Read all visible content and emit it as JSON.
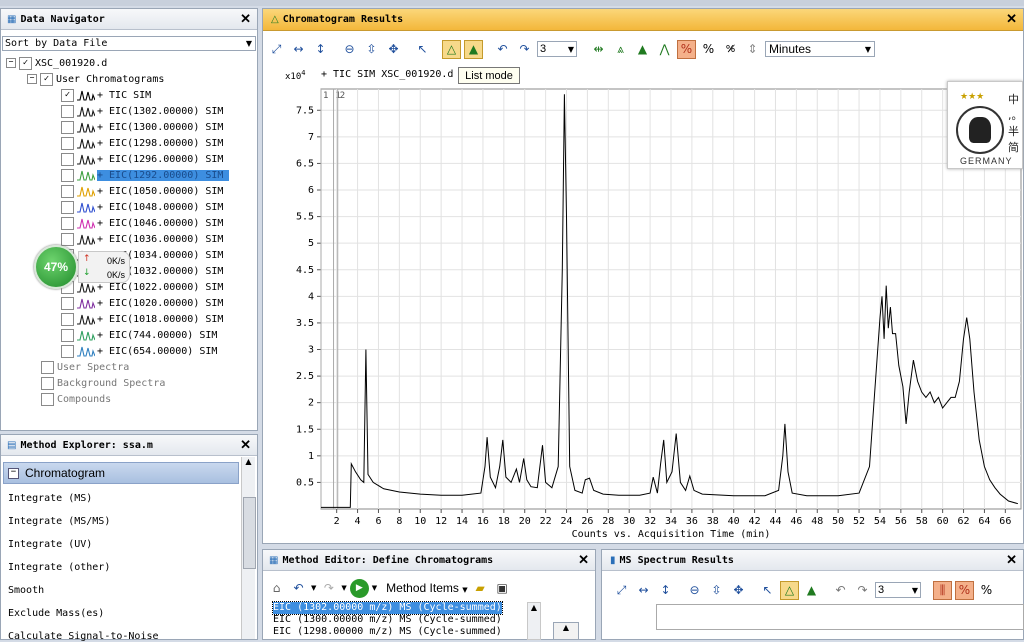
{
  "nav": {
    "title": "Data Navigator",
    "sort": "Sort by Data File",
    "file": "XSC_001920.d",
    "group": "User Chromatograms",
    "chromatograms": [
      {
        "label": "+ TIC SIM",
        "checked": true,
        "color": "#000000",
        "selected": false
      },
      {
        "label": "+ EIC(1302.00000) SIM",
        "checked": false,
        "color": "#1a1a1a",
        "selected": false
      },
      {
        "label": "+ EIC(1300.00000) SIM",
        "checked": false,
        "color": "#1a1a1a",
        "selected": false
      },
      {
        "label": "+ EIC(1298.00000) SIM",
        "checked": false,
        "color": "#1a1a1a",
        "selected": false
      },
      {
        "label": "+ EIC(1296.00000) SIM",
        "checked": false,
        "color": "#1a1a1a",
        "selected": false
      },
      {
        "label": "+ EIC(1292.00000) SIM",
        "checked": false,
        "color": "#3ea040",
        "selected": true
      },
      {
        "label": "+ EIC(1050.00000) SIM",
        "checked": false,
        "color": "#e0a000",
        "selected": false
      },
      {
        "label": "+ EIC(1048.00000) SIM",
        "checked": false,
        "color": "#3050d0",
        "selected": false
      },
      {
        "label": "+ EIC(1046.00000) SIM",
        "checked": false,
        "color": "#d030b0",
        "selected": false
      },
      {
        "label": "+ EIC(1036.00000) SIM",
        "checked": false,
        "color": "#1a1a1a",
        "selected": false
      },
      {
        "label": "+ EIC(1034.00000) SIM",
        "checked": false,
        "color": "#1a1a1a",
        "selected": false
      },
      {
        "label": "+ EIC(1032.00000) SIM",
        "checked": false,
        "color": "#1a1a1a",
        "selected": false
      },
      {
        "label": "+ EIC(1022.00000) SIM",
        "checked": false,
        "color": "#1a1a1a",
        "selected": false
      },
      {
        "label": "+ EIC(1020.00000) SIM",
        "checked": false,
        "color": "#8030a0",
        "selected": false
      },
      {
        "label": "+ EIC(1018.00000) SIM",
        "checked": false,
        "color": "#1a1a1a",
        "selected": false
      },
      {
        "label": "+ EIC(744.00000) SIM",
        "checked": false,
        "color": "#30a060",
        "selected": false
      },
      {
        "label": "+ EIC(654.00000) SIM",
        "checked": false,
        "color": "#3080c0",
        "selected": false
      }
    ],
    "other_nodes": [
      "User Spectra",
      "Background Spectra",
      "Compounds"
    ]
  },
  "net_widget": {
    "percent": "47%",
    "up": "0K/s",
    "down": "0K/s"
  },
  "method_explorer": {
    "title": "Method Explorer: ssa.m",
    "section": "Chromatogram",
    "items": [
      "Integrate (MS)",
      "Integrate (MS/MS)",
      "Integrate (UV)",
      "Integrate (other)",
      "Smooth",
      "Exclude Mass(es)",
      "Calculate Signal-to-Noise"
    ]
  },
  "chrom": {
    "title": "Chromatogram Results",
    "toolbar_number": "3",
    "units": "Minutes",
    "tooltip": "List mode",
    "exponent": "x10",
    "exponent_power": "4",
    "trace_label": "+ TIC SIM XSC_001920.d",
    "markers": [
      "1",
      "1",
      "2"
    ],
    "xlabel": "Counts vs. Acquisition Time (min)"
  },
  "chart_data": {
    "type": "line",
    "title": "+ TIC SIM XSC_001920.d",
    "xlabel": "Counts vs. Acquisition Time (min)",
    "ylabel": "",
    "xlim": [
      0.5,
      67.5
    ],
    "ylim": [
      0,
      7.9
    ],
    "x_ticks": [
      2,
      4,
      6,
      8,
      10,
      12,
      14,
      16,
      18,
      20,
      22,
      24,
      26,
      28,
      30,
      32,
      34,
      36,
      38,
      40,
      42,
      44,
      46,
      48,
      50,
      52,
      54,
      56,
      58,
      60,
      62,
      64,
      66
    ],
    "y_ticks": [
      0.5,
      1,
      1.5,
      2,
      2.5,
      3,
      3.5,
      4,
      4.5,
      5,
      5.5,
      6,
      6.5,
      7,
      7.5
    ],
    "grid": true,
    "series": [
      {
        "values": [
          [
            0.5,
            0.03
          ],
          [
            3.3,
            0.03
          ],
          [
            3.4,
            0.85
          ],
          [
            3.8,
            0.7
          ],
          [
            4.3,
            0.55
          ],
          [
            4.6,
            0.5
          ],
          [
            4.8,
            3.0
          ],
          [
            5.0,
            0.65
          ],
          [
            5.5,
            0.5
          ],
          [
            6.5,
            0.38
          ],
          [
            8,
            0.32
          ],
          [
            10,
            0.28
          ],
          [
            12,
            0.26
          ],
          [
            14,
            0.26
          ],
          [
            15.8,
            0.3
          ],
          [
            16.2,
            0.8
          ],
          [
            16.4,
            1.35
          ],
          [
            16.7,
            0.6
          ],
          [
            17.2,
            0.4
          ],
          [
            17.6,
            0.8
          ],
          [
            17.9,
            1.3
          ],
          [
            18.2,
            0.6
          ],
          [
            18.7,
            0.5
          ],
          [
            19.2,
            0.75
          ],
          [
            19.5,
            0.5
          ],
          [
            19.9,
            0.95
          ],
          [
            20.2,
            0.55
          ],
          [
            20.6,
            0.42
          ],
          [
            21.2,
            0.4
          ],
          [
            21.7,
            1.2
          ],
          [
            22.0,
            0.5
          ],
          [
            22.6,
            0.4
          ],
          [
            23.2,
            0.8
          ],
          [
            23.6,
            4.5
          ],
          [
            23.8,
            7.8
          ],
          [
            24.0,
            5.5
          ],
          [
            24.3,
            0.8
          ],
          [
            24.8,
            0.35
          ],
          [
            25.5,
            0.3
          ],
          [
            25.8,
            0.55
          ],
          [
            26.2,
            0.58
          ],
          [
            26.6,
            0.35
          ],
          [
            27.5,
            0.28
          ],
          [
            29,
            0.26
          ],
          [
            31,
            0.26
          ],
          [
            32,
            0.3
          ],
          [
            32.3,
            0.6
          ],
          [
            32.7,
            0.3
          ],
          [
            33.0,
            0.85
          ],
          [
            33.3,
            1.3
          ],
          [
            33.6,
            0.5
          ],
          [
            34.1,
            0.7
          ],
          [
            34.5,
            1.42
          ],
          [
            34.9,
            0.5
          ],
          [
            35.4,
            0.35
          ],
          [
            35.8,
            0.62
          ],
          [
            36.2,
            0.35
          ],
          [
            37,
            0.28
          ],
          [
            40,
            0.25
          ],
          [
            43,
            0.25
          ],
          [
            44.3,
            0.35
          ],
          [
            44.7,
            1.0
          ],
          [
            44.9,
            1.6
          ],
          [
            45.2,
            0.7
          ],
          [
            45.6,
            0.3
          ],
          [
            47,
            0.25
          ],
          [
            50,
            0.25
          ],
          [
            52,
            0.3
          ],
          [
            53,
            0.8
          ],
          [
            53.5,
            2.2
          ],
          [
            54.0,
            3.6
          ],
          [
            54.2,
            4.0
          ],
          [
            54.4,
            3.2
          ],
          [
            54.6,
            4.2
          ],
          [
            54.8,
            3.4
          ],
          [
            55.0,
            3.8
          ],
          [
            55.2,
            3.3
          ],
          [
            55.5,
            3.3
          ],
          [
            55.8,
            2.7
          ],
          [
            56.2,
            2.3
          ],
          [
            56.5,
            1.6
          ],
          [
            56.8,
            2.2
          ],
          [
            57.2,
            2.8
          ],
          [
            57.6,
            2.4
          ],
          [
            58.0,
            2.2
          ],
          [
            58.4,
            2.1
          ],
          [
            58.8,
            2.2
          ],
          [
            59.2,
            2.0
          ],
          [
            59.6,
            2.1
          ],
          [
            60.0,
            1.9
          ],
          [
            60.4,
            2.0
          ],
          [
            60.8,
            2.1
          ],
          [
            61.2,
            2.1
          ],
          [
            61.6,
            2.4
          ],
          [
            62.0,
            3.2
          ],
          [
            62.3,
            3.6
          ],
          [
            62.6,
            3.2
          ],
          [
            63.0,
            2.2
          ],
          [
            63.5,
            1.3
          ],
          [
            64.0,
            0.8
          ],
          [
            64.5,
            0.55
          ],
          [
            65.0,
            0.4
          ],
          [
            65.5,
            0.28
          ],
          [
            66.3,
            0.15
          ],
          [
            67.2,
            0.1
          ]
        ]
      }
    ]
  },
  "method_editor": {
    "title": "Method Editor: Define Chromatograms",
    "method_items": "Method Items",
    "rows": [
      "EIC (1302.00000 m/z) MS (Cycle-summed)",
      "EIC (1300.00000 m/z) MS (Cycle-summed)",
      "EIC (1298.00000 m/z) MS (Cycle-summed)"
    ]
  },
  "ms_spectrum": {
    "title": "MS Spectrum Results",
    "toolbar_number": "3"
  },
  "logo": {
    "country": "GERMANY",
    "chars": "中,。半简",
    "stars": "★★★"
  }
}
